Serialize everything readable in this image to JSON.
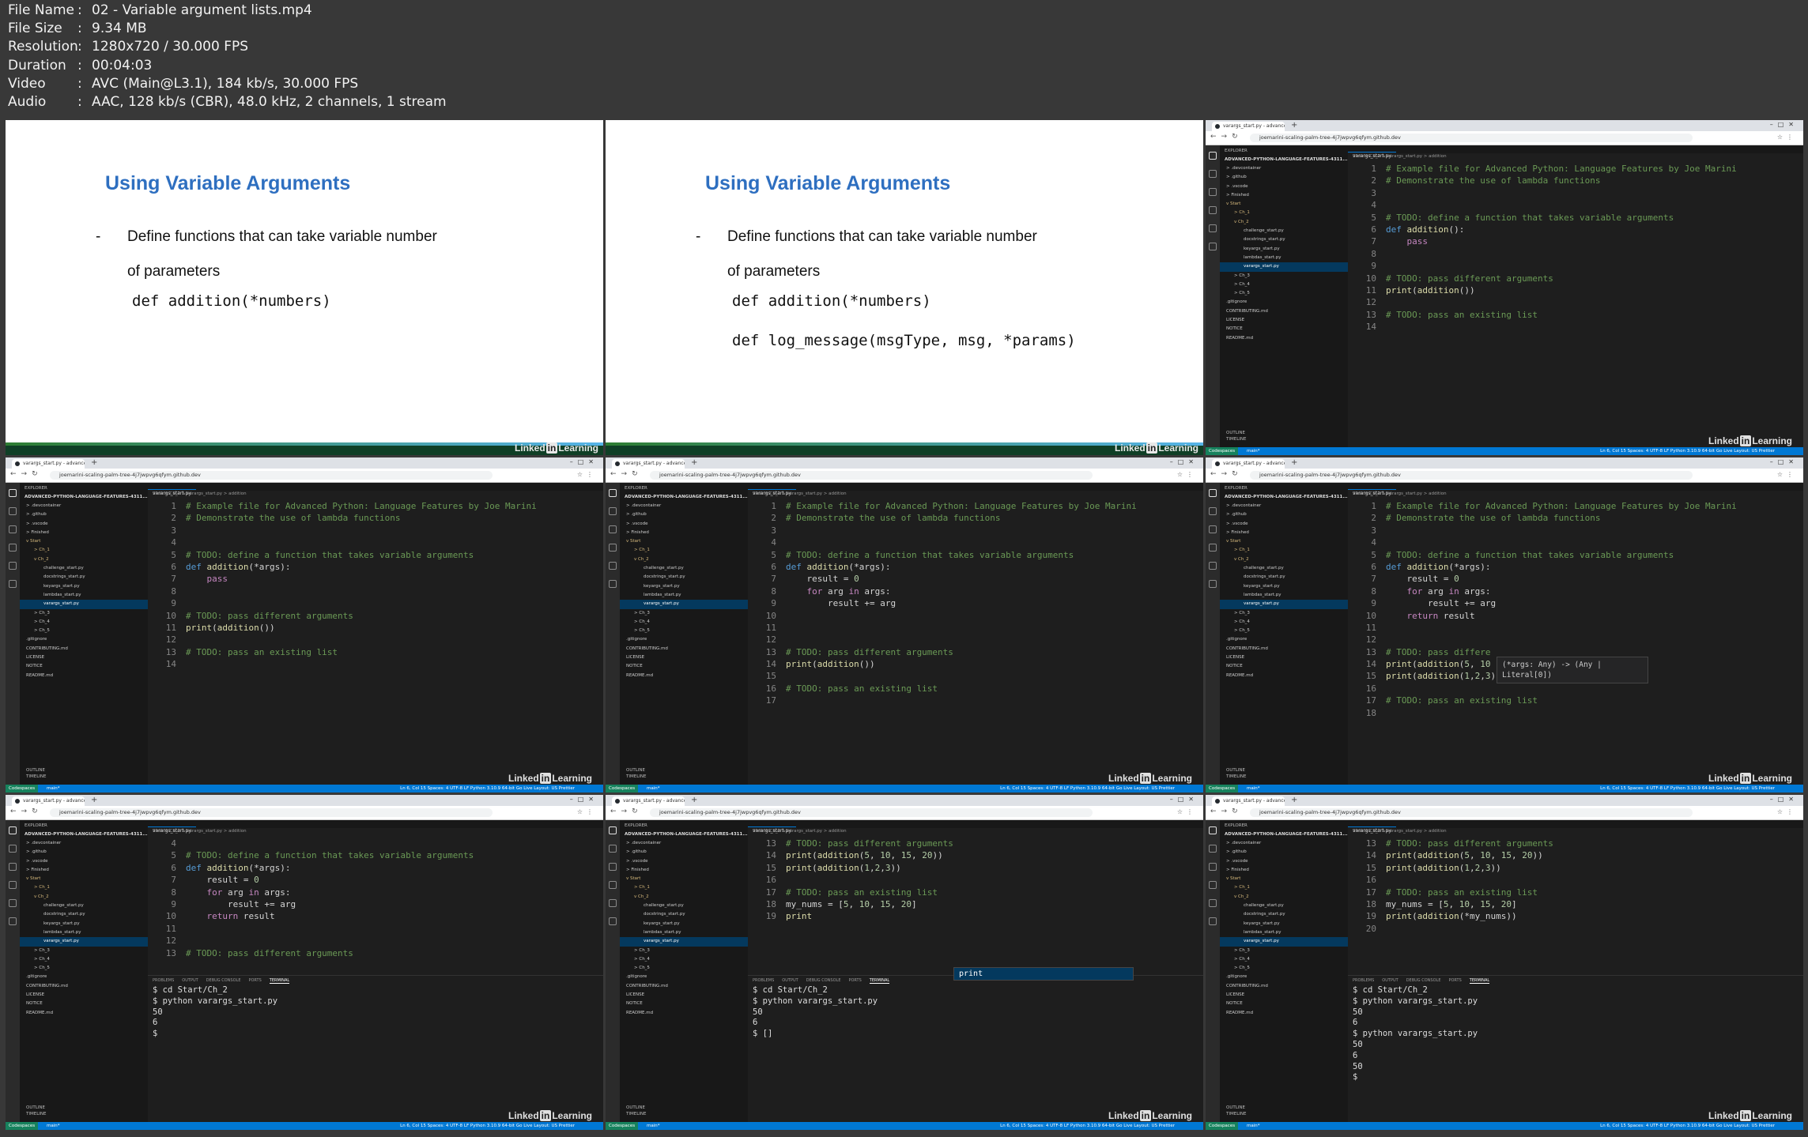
{
  "info": [
    {
      "key": "File Name",
      "value": "02 - Variable argument lists.mp4"
    },
    {
      "key": "File Size",
      "value": "9.34 MB"
    },
    {
      "key": "Resolution",
      "value": "1280x720 / 30.000 FPS"
    },
    {
      "key": "Duration",
      "value": "00:04:03"
    },
    {
      "key": "Video",
      "value": "AVC (Main@L3.1), 184 kb/s, 30.000 FPS"
    },
    {
      "key": "Audio",
      "value": "AAC, 128 kb/s (CBR), 48.0 kHz, 2 channels, 1 stream"
    }
  ],
  "slide": {
    "title": "Using Variable Arguments",
    "bullet_line1": "Define functions that can take variable number",
    "bullet_line2": "of parameters",
    "code1": "def addition(*numbers)",
    "code2": "def log_message(msgType, msg, *params)",
    "linkedin_pre": "Linked",
    "linkedin_in": "in",
    "linkedin_post": "Learning"
  },
  "browser": {
    "tab_title": "varargs_start.py - advanced-pyt...",
    "url": "joemarini-scaling-palm-tree-4j7jwpvg6qfym.github.dev"
  },
  "explorer": {
    "header": "EXPLORER",
    "project": "ADVANCED-PYTHON-LANGUAGE-FEATURES-4311...",
    "items": [
      "> .devcontainer",
      "> .github",
      "> .vscode",
      "> Finished",
      "v Start",
      "> Ch_1",
      "v Ch_2",
      "challenge_start.py",
      "docstrings_start.py",
      "keyargs_start.py",
      "lambdas_start.py",
      "varargs_start.py",
      "> Ch_3",
      "> Ch_4",
      "> Ch_5",
      ".gitignore",
      "CONTRIBUTING.md",
      "LICENSE",
      "NOTICE",
      "README.md"
    ],
    "outline": "OUTLINE",
    "timeline": "TIMELINE"
  },
  "editor": {
    "tab": "varargs_start.py",
    "breadcrumb": "Start > Ch_2 > varargs_start.py > addition",
    "hover_line1": "(*args: Any) -> (Any |",
    "hover_line2": "Literal[0])",
    "suggestion": "print"
  },
  "panel_tabs": [
    "PROBLEMS",
    "OUTPUT",
    "DEBUG CONSOLE",
    "PORTS",
    "TERMINAL"
  ],
  "status": {
    "left": "Codespaces",
    "branch": "main*",
    "right": "Ln 6, Col 15   Spaces: 4   UTF-8   LF   Python   3.10.9 64-bit   Go Live   Layout: US   Prettier"
  },
  "code_views": {
    "v3": [
      "# Example file for Advanced Python: Language Features by Joe Marini",
      "# Demonstrate the use of lambda functions",
      "",
      "",
      "# TODO: define a function that takes variable arguments",
      "def addition():",
      "    pass",
      "",
      "",
      "# TODO: pass different arguments",
      "print(addition())",
      "",
      "# TODO: pass an existing list",
      ""
    ],
    "v4": [
      "# Example file for Advanced Python: Language Features by Joe Marini",
      "# Demonstrate the use of lambda functions",
      "",
      "",
      "# TODO: define a function that takes variable arguments",
      "def addition(*args):",
      "    pass",
      "",
      "",
      "# TODO: pass different arguments",
      "print(addition())",
      "",
      "# TODO: pass an existing list",
      ""
    ],
    "v5": [
      "# Example file for Advanced Python: Language Features by Joe Marini",
      "# Demonstrate the use of lambda functions",
      "",
      "",
      "# TODO: define a function that takes variable arguments",
      "def addition(*args):",
      "    result = 0",
      "    for arg in args:",
      "        result += arg",
      "",
      "",
      "",
      "# TODO: pass different arguments",
      "print(addition())",
      "",
      "# TODO: pass an existing list",
      ""
    ],
    "v6": [
      "# Example file for Advanced Python: Language Features by Joe Marini",
      "# Demonstrate the use of lambda functions",
      "",
      "",
      "# TODO: define a function that takes variable arguments",
      "def addition(*args):",
      "    result = 0",
      "    for arg in args:",
      "        result += arg",
      "    return result",
      "",
      "",
      "# TODO: pass differe",
      "print(addition(5, 10",
      "print(addition(1,2,3))",
      "",
      "# TODO: pass an existing list",
      ""
    ],
    "v7": [
      "",
      "# TODO: define a function that takes variable arguments",
      "def addition(*args):",
      "    result = 0",
      "    for arg in args:",
      "        result += arg",
      "    return result",
      "",
      "",
      "# TODO: pass different arguments"
    ],
    "v8": [
      "# TODO: pass different arguments",
      "print(addition(5, 10, 15, 20))",
      "print(addition(1,2,3))",
      "",
      "# TODO: pass an existing list",
      "my_nums = [5, 10, 15, 20]",
      "print"
    ],
    "v9": [
      "# TODO: pass different arguments",
      "print(addition(5, 10, 15, 20))",
      "print(addition(1,2,3))",
      "",
      "# TODO: pass an existing list",
      "my_nums = [5, 10, 15, 20]",
      "print(addition(*my_nums))",
      ""
    ]
  },
  "terminal": {
    "t7": [
      "$ cd Start/Ch_2",
      "$ python varargs_start.py",
      "50",
      "6",
      "$ "
    ],
    "t8": [
      "$ cd Start/Ch_2",
      "$ python varargs_start.py",
      "50",
      "6",
      "$ []"
    ],
    "t9": [
      "$ cd Start/Ch_2",
      "$ python varargs_start.py",
      "50",
      "6",
      "$ python varargs_start.py",
      "50",
      "6",
      "50",
      "$ "
    ]
  }
}
